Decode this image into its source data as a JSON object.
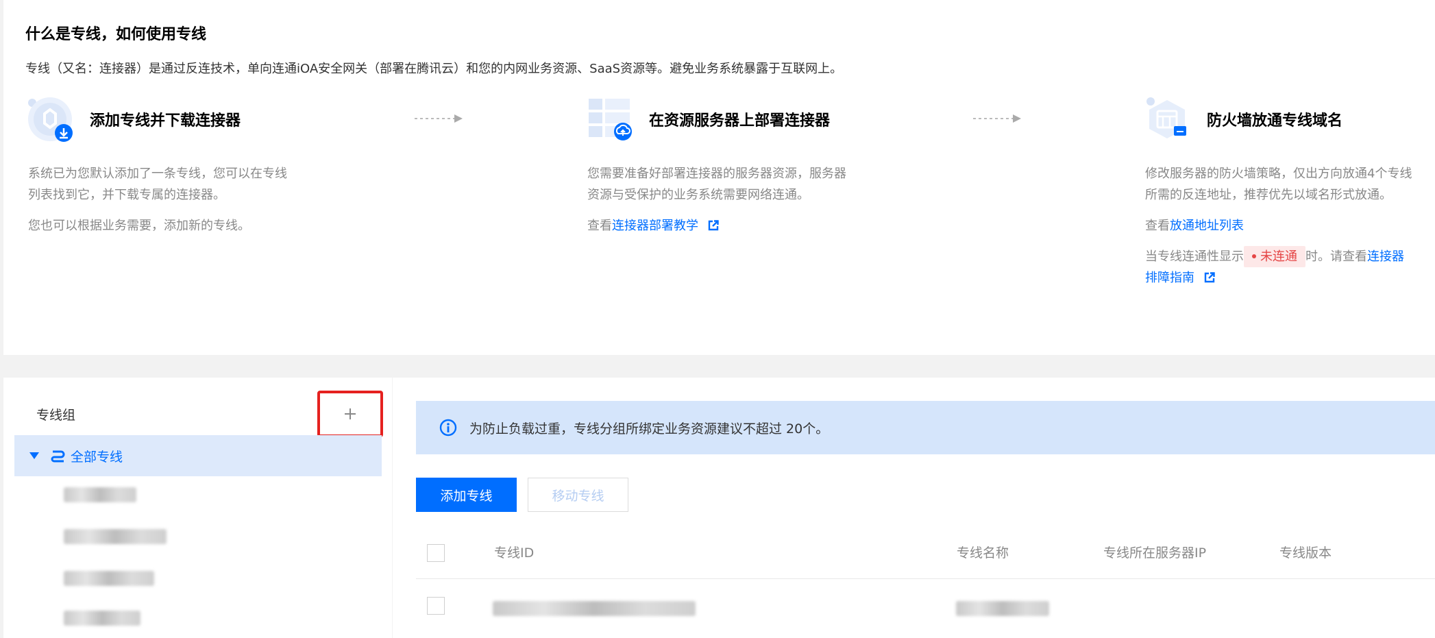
{
  "intro": {
    "title": "什么是专线，如何使用专线",
    "description": "专线（又名：连接器）是通过反连技术，单向连通iOA安全网关（部署在腾讯云）和您的内网业务资源、SaaS资源等。避免业务系统暴露于互联网上。",
    "steps": [
      {
        "title": "添加专线并下载连接器",
        "icon": "download-connector-icon",
        "paragraphs": [
          "系统已为您默认添加了一条专线，您可以在专线列表找到它，并下载专属的连接器。",
          "您也可以根据业务需要，添加新的专线。"
        ]
      },
      {
        "title": "在资源服务器上部署连接器",
        "icon": "server-deploy-icon",
        "paragraphs": [
          "您需要准备好部署连接器的服务器资源，服务器资源与受保护的业务系统需要网络连通。"
        ],
        "link_prefix": "查看",
        "link_text": "连接器部署教学"
      },
      {
        "title": "防火墙放通专线域名",
        "icon": "firewall-domain-icon",
        "paragraphs": [
          "修改服务器的防火墙策略，仅出方向放通4个专线所需的反连地址，推荐优先以域名形式放通。"
        ],
        "link_prefix": "查看",
        "link_text": "放通地址列表",
        "status_prefix": "当专线连通性显示",
        "status_badge": "未连通",
        "status_suffix": "时。请查看",
        "status_link": "连接器排障指南"
      }
    ]
  },
  "sidebar": {
    "title": "专线组",
    "add_icon": "plus-icon",
    "all_label": "全部专线",
    "items": [
      "",
      "",
      "",
      ""
    ]
  },
  "notice": {
    "text": "为防止负载过重，专线分组所绑定业务资源建议不超过 20个。",
    "icon": "info-icon"
  },
  "toolbar": {
    "add_label": "添加专线",
    "move_label": "移动专线"
  },
  "table": {
    "columns": [
      "专线ID",
      "专线名称",
      "专线所在服务器IP",
      "专线版本"
    ]
  },
  "colors": {
    "accent": "#006eff",
    "danger": "#e54545",
    "highlight_border": "#e5211f"
  }
}
